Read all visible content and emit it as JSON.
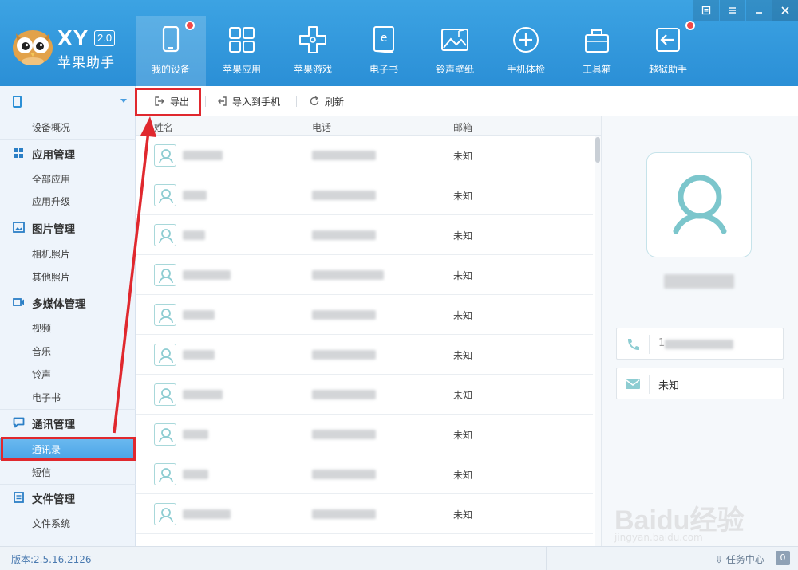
{
  "app": {
    "logo_main": "XY",
    "logo_version": "2.0",
    "logo_sub": "苹果助手"
  },
  "nav": [
    {
      "label": "我的设备",
      "icon": "device-icon",
      "badge": true,
      "active": true
    },
    {
      "label": "苹果应用",
      "icon": "apps-grid-icon",
      "badge": false
    },
    {
      "label": "苹果游戏",
      "icon": "gamepad-icon",
      "badge": false
    },
    {
      "label": "电子书",
      "icon": "ebook-icon",
      "badge": false
    },
    {
      "label": "铃声壁纸",
      "icon": "wallpaper-icon",
      "badge": false
    },
    {
      "label": "手机体检",
      "icon": "health-check-icon",
      "badge": false
    },
    {
      "label": "工具箱",
      "icon": "toolbox-icon",
      "badge": false
    },
    {
      "label": "越狱助手",
      "icon": "jailbreak-icon",
      "badge": true
    }
  ],
  "sidebar": {
    "device_overview": "设备概况",
    "groups": [
      {
        "label": "应用管理",
        "items": [
          "全部应用",
          "应用升级"
        ]
      },
      {
        "label": "图片管理",
        "items": [
          "相机照片",
          "其他照片"
        ]
      },
      {
        "label": "多媒体管理",
        "items": [
          "视频",
          "音乐",
          "铃声",
          "电子书"
        ]
      },
      {
        "label": "通讯管理",
        "items": [
          "通讯录",
          "短信"
        ]
      },
      {
        "label": "文件管理",
        "items": [
          "文件系统"
        ]
      }
    ],
    "active_item": "通讯录"
  },
  "toolbar": {
    "export_label": "导出",
    "import_label": "导入到手机",
    "refresh_label": "刷新"
  },
  "table": {
    "columns": [
      "姓名",
      "电话",
      "邮箱"
    ],
    "rows": [
      {
        "email": "未知"
      },
      {
        "email": "未知"
      },
      {
        "email": "未知"
      },
      {
        "email": "未知"
      },
      {
        "email": "未知"
      },
      {
        "email": "未知"
      },
      {
        "email": "未知"
      },
      {
        "email": "未知"
      },
      {
        "email": "未知"
      },
      {
        "email": "未知"
      }
    ]
  },
  "detail": {
    "phone_prefix": "1",
    "email": "未知"
  },
  "status": {
    "version": "版本:2.5.16.2126",
    "task_center": "任务中心",
    "task_count": "0"
  },
  "watermark": {
    "text": "Baidu经验",
    "url": "jingyan.baidu.com"
  },
  "colors": {
    "header_blue": "#2b8fd6",
    "highlight_red": "#e0282e",
    "avatar_teal": "#7cc6cc"
  }
}
